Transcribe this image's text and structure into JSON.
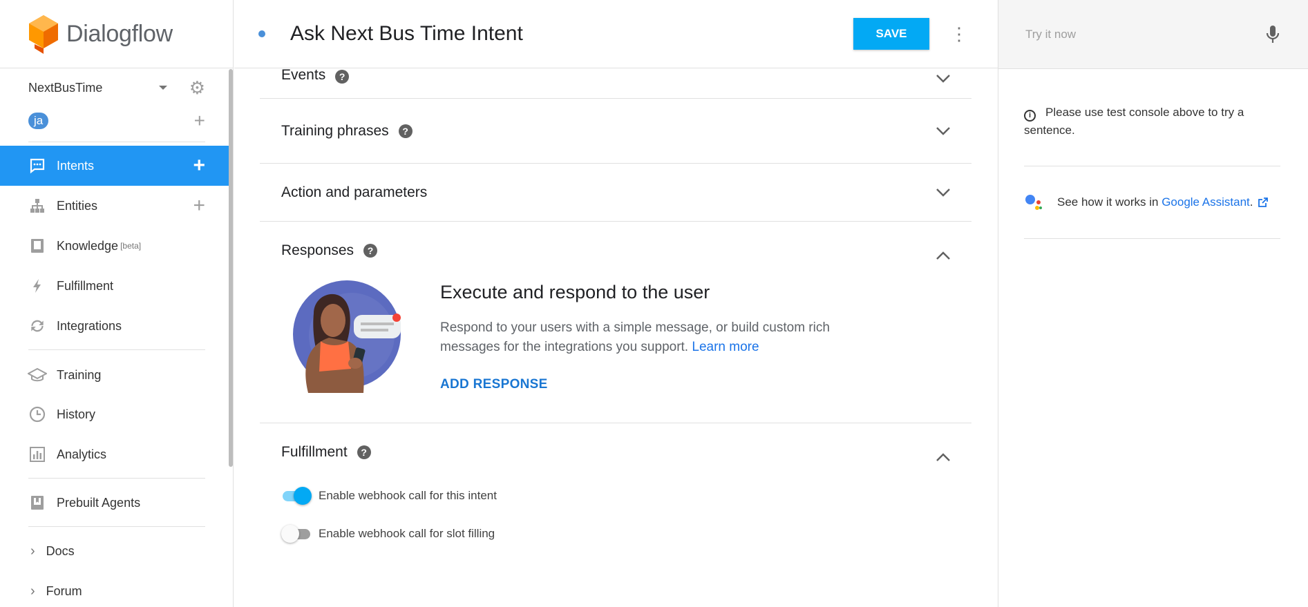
{
  "app": {
    "name": "Dialogflow"
  },
  "sidebar": {
    "agent_name": "NextBusTime",
    "language": "ja",
    "items": [
      {
        "label": "Intents",
        "icon": "chat-bubble-icon"
      },
      {
        "label": "Entities",
        "icon": "hierarchy-icon"
      },
      {
        "label": "Knowledge",
        "badge": "[beta]",
        "icon": "book-icon"
      },
      {
        "label": "Fulfillment",
        "icon": "lightning-icon"
      },
      {
        "label": "Integrations",
        "icon": "sync-icon"
      },
      {
        "label": "Training",
        "icon": "graduation-cap-icon"
      },
      {
        "label": "History",
        "icon": "clock-icon"
      },
      {
        "label": "Analytics",
        "icon": "bar-chart-icon"
      },
      {
        "label": "Prebuilt Agents",
        "icon": "prebuilt-book-icon"
      },
      {
        "label": "Docs",
        "icon": "chevron-right-icon"
      },
      {
        "label": "Forum",
        "icon": "chevron-right-icon"
      }
    ]
  },
  "header": {
    "title": "Ask Next Bus Time Intent",
    "save_label": "SAVE"
  },
  "sections": {
    "events": "Events",
    "training": "Training phrases",
    "action": "Action and parameters",
    "responses": "Responses",
    "fulfillment": "Fulfillment"
  },
  "responses": {
    "heading": "Execute and respond to the user",
    "description": "Respond to your users with a simple message, or build custom rich messages for the integrations you support.",
    "learn_more": "Learn more",
    "add_response": "ADD RESPONSE"
  },
  "fulfillment": {
    "webhook_intent": {
      "label": "Enable webhook call for this intent",
      "enabled": true
    },
    "webhook_slot": {
      "label": "Enable webhook call for slot filling",
      "enabled": false
    }
  },
  "test_panel": {
    "placeholder": "Try it now",
    "info": "Please use test console above to try a sentence.",
    "assistant_prefix": "See how it works in",
    "assistant_link": "Google Assistant",
    "assistant_suffix": "."
  },
  "colors": {
    "accent": "#2196f3",
    "save": "#03a9f4",
    "logo_orange": "#ef6c00",
    "link": "#1a73e8"
  }
}
